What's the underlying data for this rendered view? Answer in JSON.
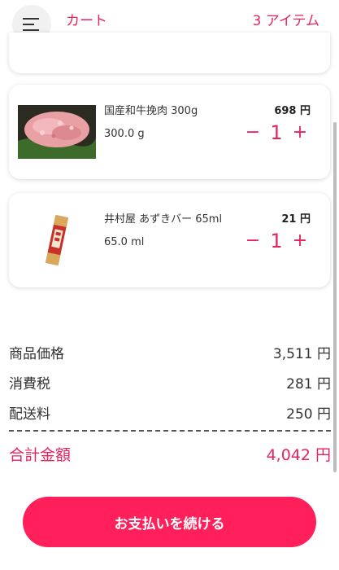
{
  "header": {
    "menu_icon": "hamburger-menu-icon",
    "title": "カート",
    "item_count": "3 アイテム"
  },
  "items": [
    {
      "name": "国産和牛挽肉 300g",
      "price": "698 円",
      "weight": "300.0 g",
      "quantity": "1",
      "image_icon": "ground-beef-image"
    },
    {
      "name": "井村屋 あずきバー 65ml",
      "price": "21 円",
      "weight": "65.0 ml",
      "quantity": "1",
      "image_icon": "azuki-bar-image"
    }
  ],
  "stepper": {
    "minus": "−",
    "plus": "+"
  },
  "summary": {
    "subtotal_label": "商品価格",
    "subtotal_value": "3,511 円",
    "tax_label": "消費税",
    "tax_value": "281 円",
    "shipping_label": "配送料",
    "shipping_value": "250 円",
    "total_label": "合計金額",
    "total_value": "4,042 円"
  },
  "checkout_button": "お支払いを続ける",
  "colors": {
    "accent": "#e8225e",
    "button": "#ff1f5a",
    "text": "#333333"
  }
}
